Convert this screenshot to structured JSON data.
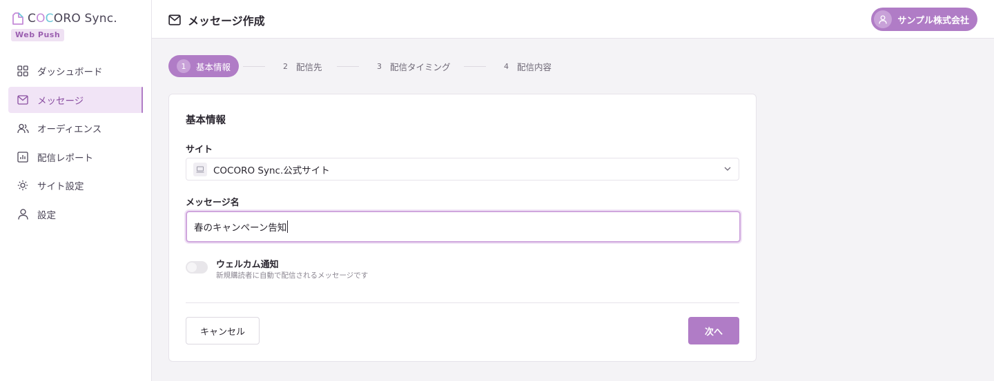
{
  "app": {
    "logo_text_parts": [
      "C",
      "O",
      "C",
      "ORO Sync."
    ],
    "badge": "Web Push"
  },
  "sidebar": {
    "items": [
      {
        "label": "ダッシュボード",
        "icon": "grid-icon",
        "active": false
      },
      {
        "label": "メッセージ",
        "icon": "mail-icon",
        "active": true
      },
      {
        "label": "オーディエンス",
        "icon": "users-icon",
        "active": false
      },
      {
        "label": "配信レポート",
        "icon": "chart-icon",
        "active": false
      },
      {
        "label": "サイト設定",
        "icon": "sun-icon",
        "active": false
      },
      {
        "label": "設定",
        "icon": "user-icon",
        "active": false
      }
    ]
  },
  "header": {
    "title": "メッセージ作成",
    "account_name": "サンプル株式会社"
  },
  "stepper": {
    "steps": [
      {
        "num": "1",
        "label": "基本情報",
        "active": true
      },
      {
        "num": "2",
        "label": "配信先",
        "active": false
      },
      {
        "num": "3",
        "label": "配信タイミング",
        "active": false
      },
      {
        "num": "4",
        "label": "配信内容",
        "active": false
      }
    ]
  },
  "form": {
    "section_title": "基本情報",
    "site_label": "サイト",
    "site_value": "COCORO Sync.公式サイト",
    "message_name_label": "メッセージ名",
    "message_name_value": "春のキャンペーン告知",
    "welcome_toggle_label": "ウェルカム通知",
    "welcome_toggle_desc": "新規購読者に自動で配信されるメッセージです",
    "welcome_toggle_on": false,
    "cancel_label": "キャンセル",
    "next_label": "次へ"
  },
  "colors": {
    "accent": "#b07cc6",
    "accent_light": "#f1e4f6",
    "logo_pink": "#c48ad8",
    "logo_cyan": "#6cc6d8"
  }
}
